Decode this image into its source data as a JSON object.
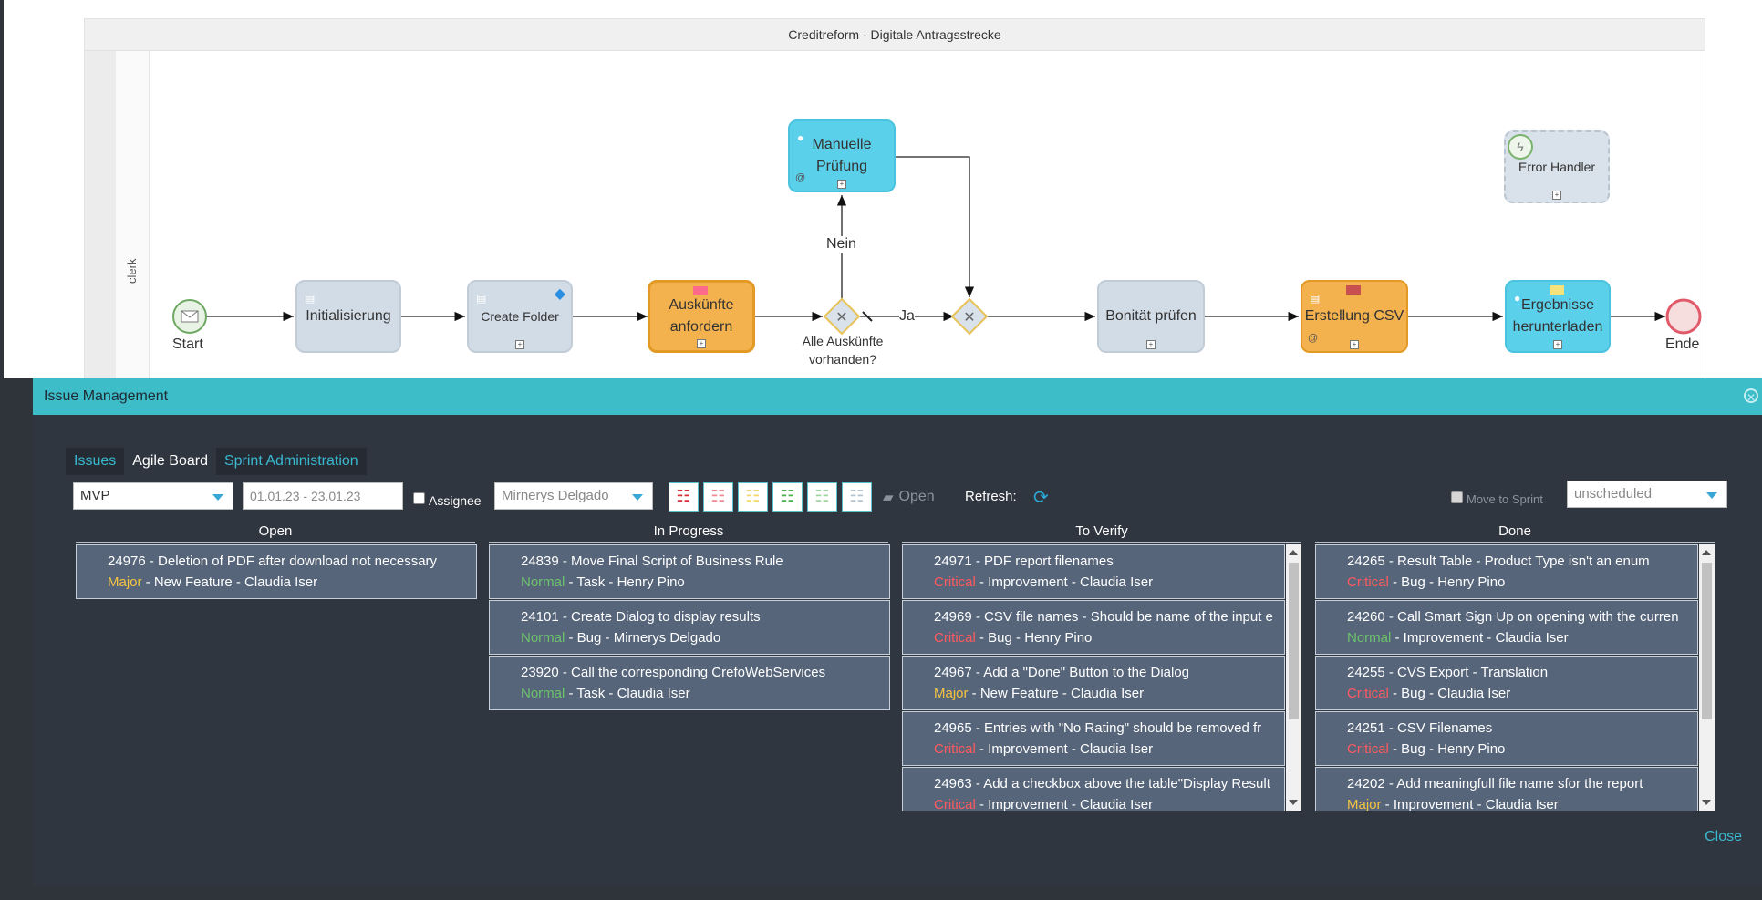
{
  "diagram": {
    "pool_title": "Creditreform - Digitale Antragsstrecke",
    "lane_label": "clerk",
    "start_label": "Start",
    "end_label": "Ende",
    "tasks": {
      "initialisierung": "Initialisierung",
      "create_folder": "Create Folder",
      "auskuenfte_1": "Auskünfte",
      "auskuenfte_2": "anfordern",
      "manuelle_1": "Manuelle",
      "manuelle_2": "Prüfung",
      "bonitaet": "Bonität prüfen",
      "erstellung_csv": "Erstellung CSV",
      "ergebnisse_1": "Ergebnisse",
      "ergebnisse_2": "herunterladen",
      "error_handler": "Error Handler"
    },
    "gateway_label_1": "Alle Auskünfte",
    "gateway_label_2": "vorhanden?",
    "flow_nein": "Nein",
    "flow_ja": "Ja"
  },
  "panel": {
    "title": "Issue Management",
    "tabs": [
      "Issues",
      "Agile Board",
      "Sprint Administration"
    ],
    "toolbar": {
      "project": "MVP",
      "date_range": "01.01.23 - 23.01.23",
      "assignee_label": "Assignee",
      "assignee_value": "Mirnerys Delgado",
      "open_label": "Open",
      "refresh_label": "Refresh:",
      "move_to_sprint_label": "Move to Sprint",
      "sprint_value": "unscheduled"
    },
    "columns": {
      "open": {
        "title": "Open",
        "cards": [
          {
            "title": "24976 - Deletion of PDF after download not necessary",
            "priority": "Major",
            "rest": " - New Feature - Claudia Iser"
          }
        ]
      },
      "in_progress": {
        "title": "In Progress",
        "cards": [
          {
            "title": "24839 - Move Final Script of Business Rule",
            "priority": "Normal",
            "rest": " - Task - Henry Pino"
          },
          {
            "title": "24101 - Create Dialog to display results",
            "priority": "Normal",
            "rest": " - Bug - Mirnerys Delgado"
          },
          {
            "title": "23920 - Call the corresponding CrefoWebServices",
            "priority": "Normal",
            "rest": " - Task - Claudia Iser"
          }
        ]
      },
      "to_verify": {
        "title": "To Verify",
        "cards": [
          {
            "title": "24971 - PDF report filenames",
            "priority": "Critical",
            "rest": " - Improvement - Claudia Iser"
          },
          {
            "title": "24969 - CSV file names - Should be name of the input e",
            "priority": "Critical",
            "rest": " - Bug - Henry Pino"
          },
          {
            "title": "24967 - Add a \"Done\" Button to the Dialog",
            "priority": "Major",
            "rest": " - New Feature - Claudia Iser"
          },
          {
            "title": "24965 - Entries with \"No Rating\" should be removed fr",
            "priority": "Critical",
            "rest": " - Improvement - Claudia Iser"
          },
          {
            "title": "24963 - Add a checkbox above the table\"Display Result",
            "priority": "Critical",
            "rest": " - Improvement - Claudia Iser"
          }
        ]
      },
      "done": {
        "title": "Done",
        "cards": [
          {
            "title": "24265 - Result Table - Product Type isn't an enum",
            "priority": "Critical",
            "rest": " - Bug - Henry Pino"
          },
          {
            "title": "24260 - Call Smart Sign Up on opening with the curren",
            "priority": "Normal",
            "rest": " - Improvement - Claudia Iser"
          },
          {
            "title": "24255 - CVS Export - Translation",
            "priority": "Critical",
            "rest": " - Bug - Claudia Iser"
          },
          {
            "title": "24251 - CSV Filenames",
            "priority": "Critical",
            "rest": " - Bug - Henry Pino"
          },
          {
            "title": "24202 - Add meaningfull file name sfor the report",
            "priority": "Major",
            "rest": " - Improvement - Claudia Iser"
          }
        ]
      }
    },
    "close_label": "Close"
  },
  "colors": {
    "priority_major": "#f5c342",
    "priority_normal": "#6cc36c",
    "priority_critical": "#ff5a5f",
    "accent": "#3dbdc8",
    "card_bg": "#56657a"
  },
  "icons": [
    "user-icon",
    "document-icon",
    "diamond-icon",
    "flag-icon",
    "paperclip-icon",
    "envelope-icon",
    "error-icon",
    "checklist-icon",
    "folder-open-icon",
    "refresh-icon",
    "close-icon",
    "chevron-down-icon"
  ]
}
